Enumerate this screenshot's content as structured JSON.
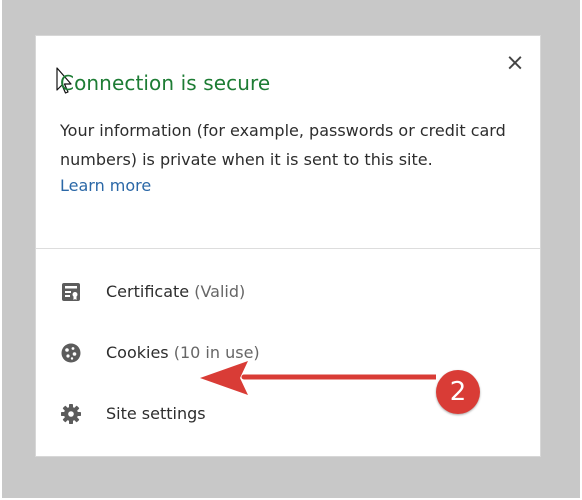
{
  "popup": {
    "close_label": "×",
    "title": "Connection is secure",
    "description": "Your information (for example, passwords or credit card numbers) is private when it is sent to this site.",
    "learn_more": "Learn more",
    "items": [
      {
        "label": "Certificate",
        "suffix": " (Valid)",
        "icon": "certificate-icon"
      },
      {
        "label": "Cookies",
        "suffix": " (10 in use)",
        "icon": "cookie-icon"
      },
      {
        "label": "Site settings",
        "suffix": "",
        "icon": "gear-icon"
      }
    ]
  },
  "annotation": {
    "badge_number": "2",
    "badge_color": "#d93c36",
    "arrow_color": "#d93c36"
  },
  "colors": {
    "title": "#1d7c34",
    "link": "#2b68a7",
    "text": "#2d2d2d",
    "background": "#c8c8c8"
  }
}
